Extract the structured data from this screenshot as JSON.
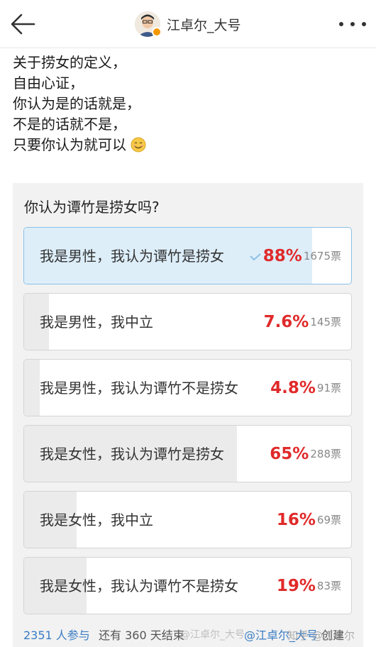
{
  "header": {
    "username": "江卓尔_大号"
  },
  "post": {
    "lines": [
      "关于捞女的定义，",
      "自由心证，",
      "你认为是的话就是，",
      "不是的话就不是，",
      "只要你认为就可以"
    ]
  },
  "vote": {
    "question": "你认为谭竹是捞女吗?",
    "options": [
      {
        "label": "我是男性，我认为谭竹是捞女",
        "percent": "88%",
        "votes": "1675票",
        "fill": 0.88,
        "selected": true
      },
      {
        "label": "我是男性，我中立",
        "percent": "7.6%",
        "votes": "145票",
        "fill": 0.076,
        "selected": false
      },
      {
        "label": "我是男性，我认为谭竹不是捞女",
        "percent": "4.8%",
        "votes": "91票",
        "fill": 0.048,
        "selected": false
      },
      {
        "label": "我是女性，我认为谭竹是捞女",
        "percent": "65%",
        "votes": "288票",
        "fill": 0.65,
        "selected": false
      },
      {
        "label": "我是女性，我中立",
        "percent": "16%",
        "votes": "69票",
        "fill": 0.16,
        "selected": false
      },
      {
        "label": "我是女性，我认为谭竹不是捞女",
        "percent": "19%",
        "votes": "83票",
        "fill": 0.19,
        "selected": false
      }
    ],
    "participants": "2351 人参与",
    "remaining": "还有 360 天结束",
    "creator": "@江卓尔_大号",
    "created_label": "创建"
  },
  "watermark": {
    "zhihu": "知乎 @江卓尔",
    "weibo": "@江卓尔_大号"
  },
  "colors": {
    "percent_red": "#e02a2a",
    "link_blue": "#3a7cc4",
    "selected_border": "#8cc0e6",
    "selected_fill": "#ddeef9"
  }
}
